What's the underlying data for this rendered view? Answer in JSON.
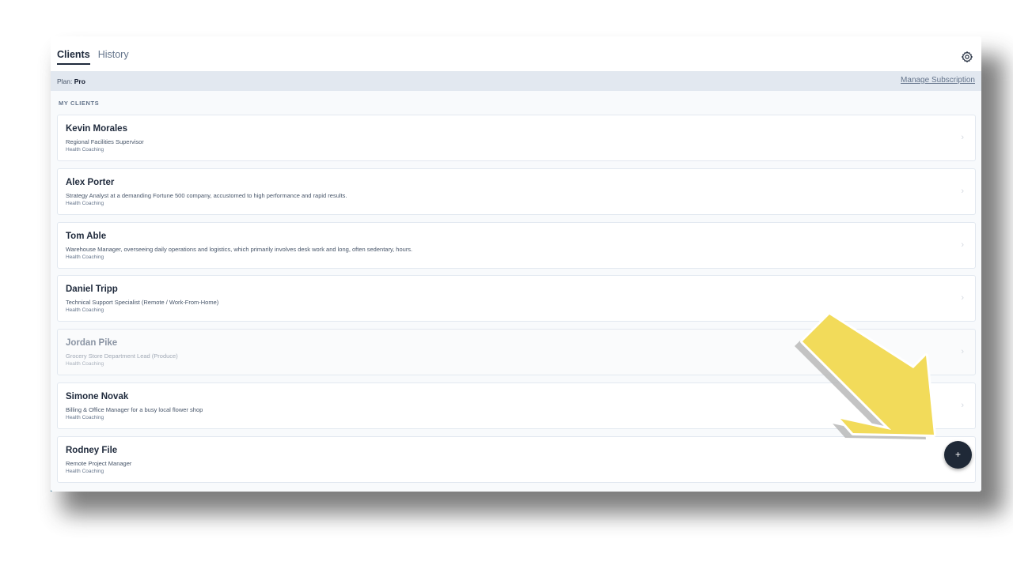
{
  "tabs": [
    {
      "label": "Clients",
      "active": true
    },
    {
      "label": "History",
      "active": false
    }
  ],
  "header": {
    "settings_icon": "gear-icon"
  },
  "plan": {
    "label": "Plan:",
    "value": "Pro",
    "manage_label": "Manage Subscription"
  },
  "section": {
    "title": "MY CLIENTS"
  },
  "clients": [
    {
      "name": "Kevin Morales",
      "role": "Regional Facilities Supervisor",
      "program": "Health Coaching"
    },
    {
      "name": "Alex Porter",
      "role": "Strategy Analyst at a demanding Fortune 500 company, accustomed to high performance and rapid results.",
      "program": "Health Coaching"
    },
    {
      "name": "Tom Able",
      "role": "Warehouse Manager, overseeing daily operations and logistics, which primarily involves desk work and long, often sedentary, hours.",
      "program": "Health Coaching"
    },
    {
      "name": "Daniel Tripp",
      "role": "Technical Support Specialist (Remote / Work-From-Home)",
      "program": "Health Coaching"
    },
    {
      "name": "Jordan Pike",
      "role": "Grocery Store Department Lead (Produce)",
      "program": "Health Coaching"
    },
    {
      "name": "Simone Novak",
      "role": "Billing & Office Manager for a busy local flower shop",
      "program": "Health Coaching"
    },
    {
      "name": "Rodney File",
      "role": "Remote Project Manager",
      "program": "Health Coaching"
    }
  ],
  "fab": {
    "label": "+"
  },
  "colors": {
    "annotation_arrow": "#f2db5a",
    "fab": "#1f2937",
    "plan_bar": "#e2e8f0"
  }
}
